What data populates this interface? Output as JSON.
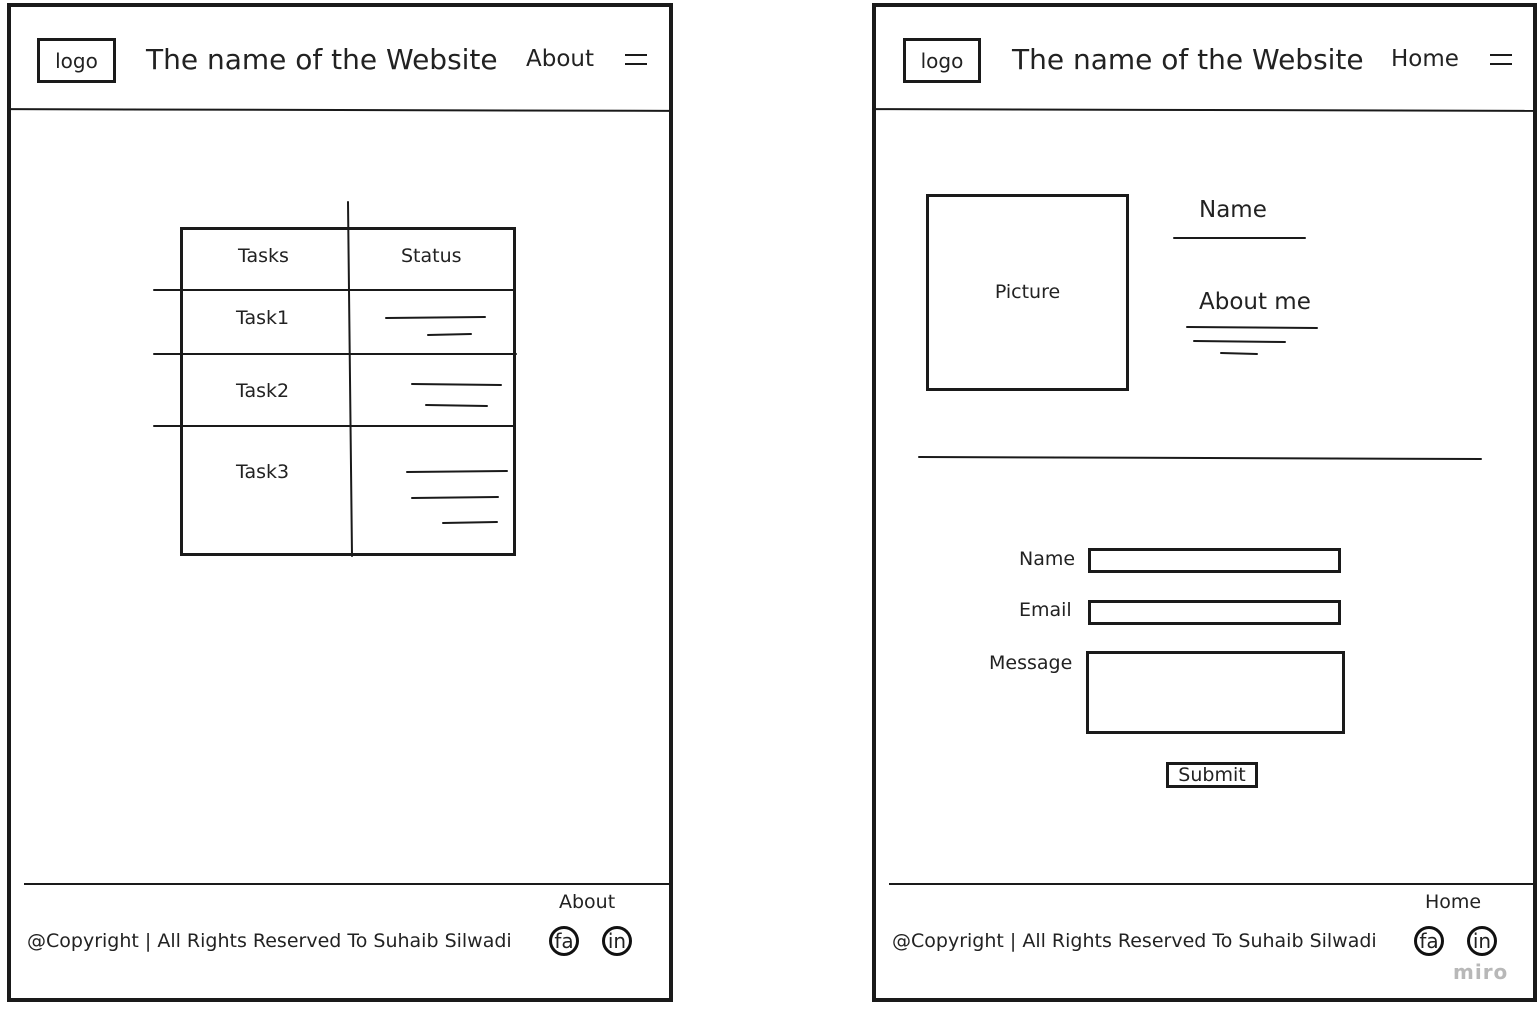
{
  "left": {
    "logo": "logo",
    "site_title": "The name of the Website",
    "nav_link": "About",
    "menu_icon": "hamburger-icon",
    "table": {
      "headers": [
        "Tasks",
        "Status"
      ],
      "rows": [
        "Task1",
        "Task2",
        "Task3"
      ]
    },
    "footer": {
      "nav_link": "About",
      "copyright": "@Copyright | All Rights Reserved To Suhaib Silwadi",
      "social": [
        "fa",
        "in"
      ]
    }
  },
  "right": {
    "logo": "logo",
    "site_title": "The name of the Website",
    "nav_link": "Home",
    "menu_icon": "hamburger-icon",
    "profile": {
      "picture_label": "Picture",
      "name_label": "Name",
      "about_label": "About me"
    },
    "form": {
      "name_label": "Name",
      "email_label": "Email",
      "message_label": "Message",
      "submit_label": "Submit"
    },
    "footer": {
      "nav_link": "Home",
      "copyright": "@Copyright | All Rights Reserved To Suhaib Silwadi",
      "social": [
        "fa",
        "in"
      ]
    },
    "watermark": "miro"
  }
}
